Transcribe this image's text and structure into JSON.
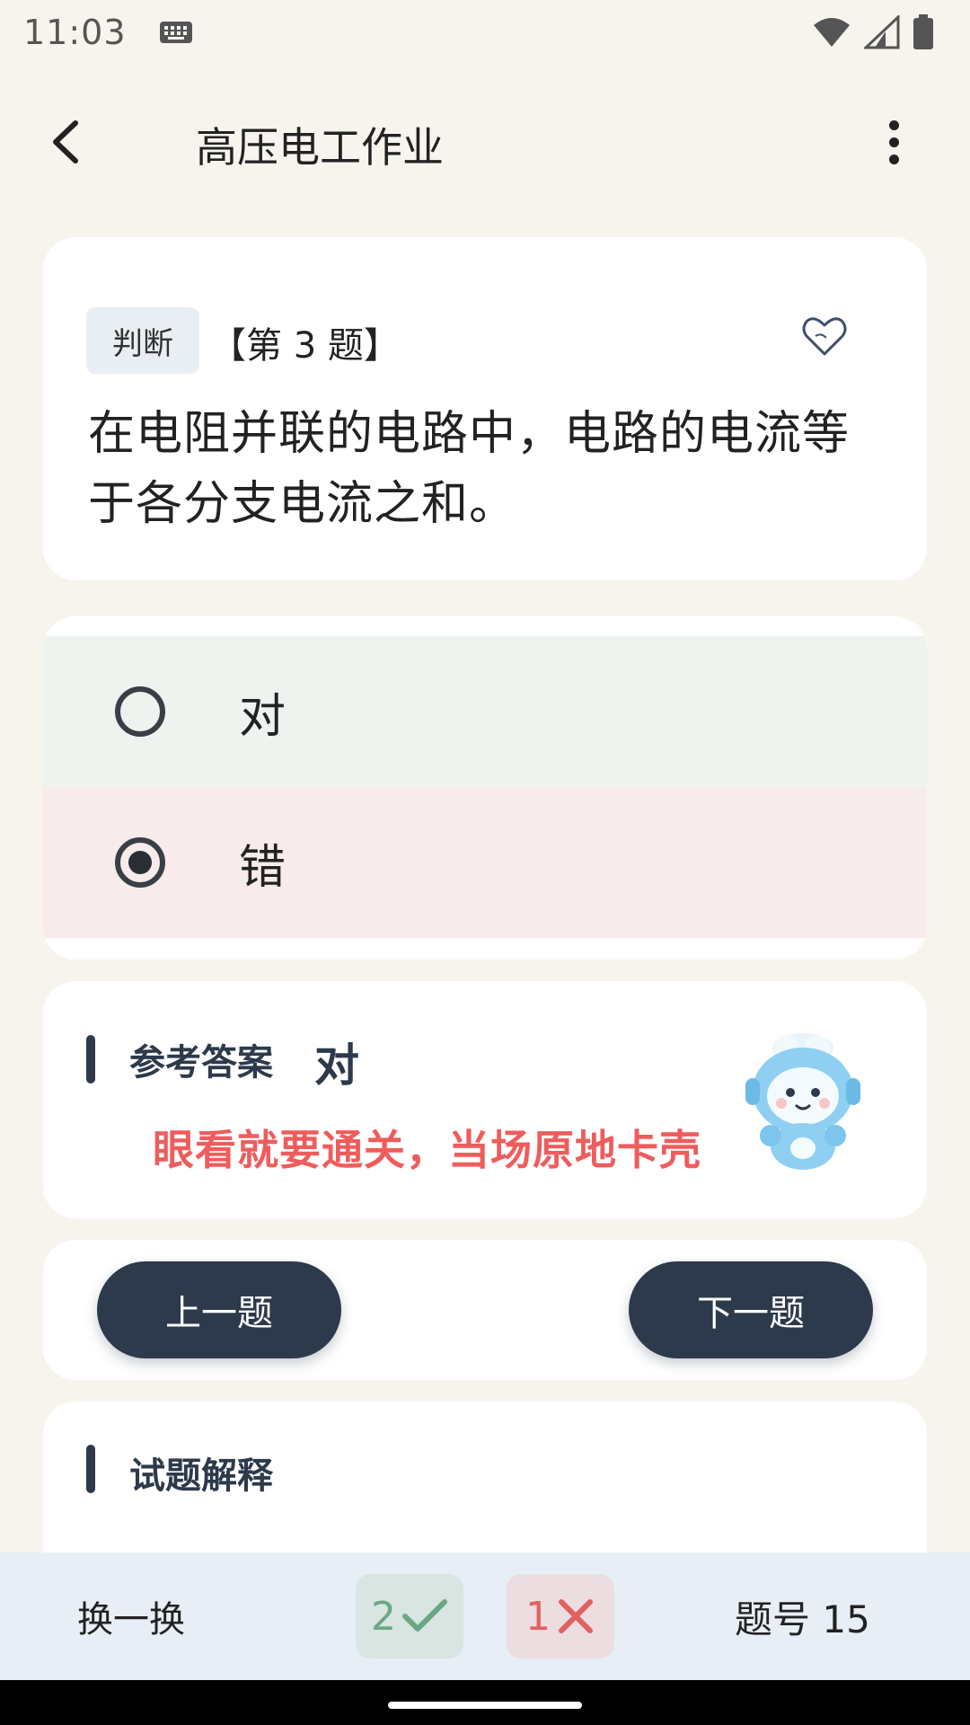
{
  "status": {
    "time": "11:03"
  },
  "header": {
    "title": "高压电工作业"
  },
  "question": {
    "type_tag": "判断",
    "number_label": "【第 3 题】",
    "text": "在电阻并联的电路中，电路的电流等于各分支电流之和。"
  },
  "options": [
    {
      "label": "对",
      "selected": false,
      "state": "correct"
    },
    {
      "label": "错",
      "selected": true,
      "state": "wrong"
    }
  ],
  "answer": {
    "heading": "参考答案",
    "value": "对",
    "slogan": "眼看就要通关，当场原地卡壳"
  },
  "nav": {
    "prev_label": "上一题",
    "next_label": "下一题"
  },
  "explanation": {
    "heading": "试题解释"
  },
  "bottom": {
    "swap_label": "换一换",
    "correct_count": "2",
    "wrong_count": "1",
    "question_no": "题号 15"
  },
  "colors": {
    "accent": "#2d3a4c",
    "correct_bg": "#eef3ef",
    "wrong_bg": "#f7ebeb",
    "slogan": "#ef5c5c",
    "page_bg": "#f7f4ee"
  }
}
